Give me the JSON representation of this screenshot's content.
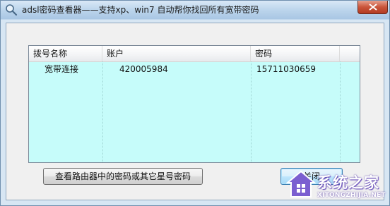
{
  "window": {
    "title": "adsl密码查看器——支持xp、win7 自动帮你找回所有宽带密码"
  },
  "list": {
    "columns": [
      "拨号名称",
      "账户",
      "密码"
    ],
    "rows": [
      {
        "name": "宽带连接",
        "account": "420005984",
        "password": "15711030659"
      }
    ]
  },
  "buttons": {
    "router": "查看路由器中的密码或其它星号密码",
    "close": "关闭"
  },
  "watermark": {
    "cn": "系统之家",
    "en": "XITONGZHIJIA.NET"
  },
  "colors": {
    "list_background": "#c6fcfa",
    "title_close": "#c9543a",
    "watermark": "#6b4fc0"
  }
}
